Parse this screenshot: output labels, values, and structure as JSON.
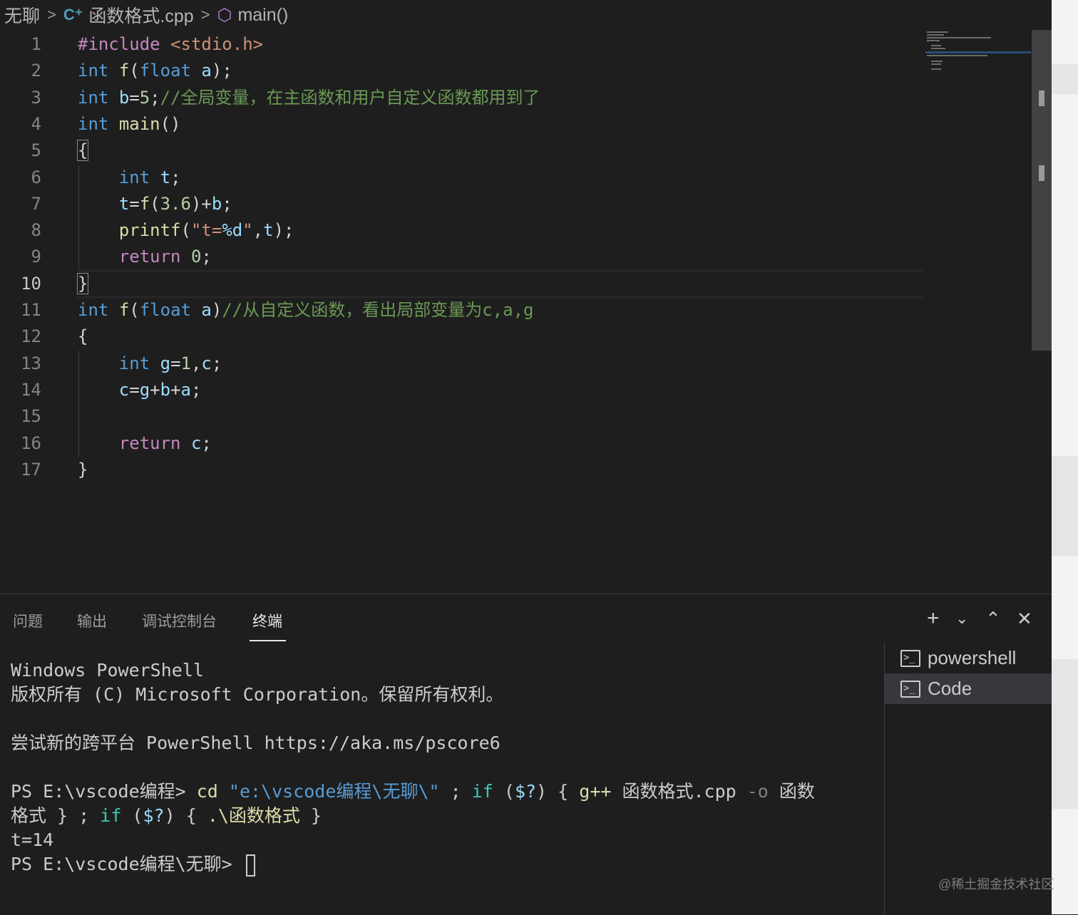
{
  "breadcrumb": {
    "folder": "无聊",
    "file_icon": "cpp-file-icon",
    "file": "函数格式.cpp",
    "symbol_icon": "method-cube-icon",
    "symbol": "main()"
  },
  "editor": {
    "language": "C",
    "active_line": 10,
    "line_numbers": [
      "1",
      "2",
      "3",
      "4",
      "5",
      "6",
      "7",
      "8",
      "9",
      "10",
      "11",
      "12",
      "13",
      "14",
      "15",
      "16",
      "17"
    ],
    "lines": [
      [
        {
          "t": "#include ",
          "c": "pp"
        },
        {
          "t": "<stdio.h>",
          "c": "str"
        }
      ],
      [
        {
          "t": "int",
          "c": "kw"
        },
        {
          "t": " "
        },
        {
          "t": "f",
          "c": "fn"
        },
        {
          "t": "("
        },
        {
          "t": "float",
          "c": "kw"
        },
        {
          "t": " "
        },
        {
          "t": "a",
          "c": "var"
        },
        {
          "t": ");"
        }
      ],
      [
        {
          "t": "int",
          "c": "kw"
        },
        {
          "t": " "
        },
        {
          "t": "b",
          "c": "var"
        },
        {
          "t": "="
        },
        {
          "t": "5",
          "c": "num"
        },
        {
          "t": ";"
        },
        {
          "t": "//全局变量，在主函数和用户自定义函数都用到了",
          "c": "cmt"
        }
      ],
      [
        {
          "t": "int",
          "c": "kw"
        },
        {
          "t": " "
        },
        {
          "t": "main",
          "c": "fn"
        },
        {
          "t": "()"
        }
      ],
      [
        {
          "t": "{",
          "c": "brkt"
        }
      ],
      [
        {
          "t": "    "
        },
        {
          "t": "int",
          "c": "kw"
        },
        {
          "t": " "
        },
        {
          "t": "t",
          "c": "var"
        },
        {
          "t": ";"
        }
      ],
      [
        {
          "t": "    "
        },
        {
          "t": "t",
          "c": "var"
        },
        {
          "t": "="
        },
        {
          "t": "f",
          "c": "fn"
        },
        {
          "t": "("
        },
        {
          "t": "3.6",
          "c": "num"
        },
        {
          "t": ")+"
        },
        {
          "t": "b",
          "c": "var"
        },
        {
          "t": ";"
        }
      ],
      [
        {
          "t": "    "
        },
        {
          "t": "printf",
          "c": "fn"
        },
        {
          "t": "("
        },
        {
          "t": "\"t=",
          "c": "str"
        },
        {
          "t": "%d",
          "c": "var"
        },
        {
          "t": "\"",
          "c": "str"
        },
        {
          "t": ","
        },
        {
          "t": "t",
          "c": "var"
        },
        {
          "t": ");"
        }
      ],
      [
        {
          "t": "    "
        },
        {
          "t": "return",
          "c": "ctl"
        },
        {
          "t": " "
        },
        {
          "t": "0",
          "c": "num"
        },
        {
          "t": ";"
        }
      ],
      [
        {
          "t": "}",
          "c": "brkt"
        }
      ],
      [
        {
          "t": "int",
          "c": "kw"
        },
        {
          "t": " "
        },
        {
          "t": "f",
          "c": "fn"
        },
        {
          "t": "("
        },
        {
          "t": "float",
          "c": "kw"
        },
        {
          "t": " "
        },
        {
          "t": "a",
          "c": "var"
        },
        {
          "t": ")"
        },
        {
          "t": "//从自定义函数，看出局部变量为c,a,g",
          "c": "cmt"
        }
      ],
      [
        {
          "t": "{"
        }
      ],
      [
        {
          "t": "    "
        },
        {
          "t": "int",
          "c": "kw"
        },
        {
          "t": " "
        },
        {
          "t": "g",
          "c": "var"
        },
        {
          "t": "="
        },
        {
          "t": "1",
          "c": "num"
        },
        {
          "t": ","
        },
        {
          "t": "c",
          "c": "var"
        },
        {
          "t": ";"
        }
      ],
      [
        {
          "t": "    "
        },
        {
          "t": "c",
          "c": "var"
        },
        {
          "t": "="
        },
        {
          "t": "g",
          "c": "var"
        },
        {
          "t": "+"
        },
        {
          "t": "b",
          "c": "var"
        },
        {
          "t": "+"
        },
        {
          "t": "a",
          "c": "var"
        },
        {
          "t": ";"
        }
      ],
      [],
      [
        {
          "t": "    "
        },
        {
          "t": "return",
          "c": "ctl"
        },
        {
          "t": " "
        },
        {
          "t": "c",
          "c": "var"
        },
        {
          "t": ";"
        }
      ],
      [
        {
          "t": "}"
        }
      ]
    ]
  },
  "panel": {
    "tabs": [
      "问题",
      "输出",
      "调试控制台",
      "终端"
    ],
    "active_tab": "终端",
    "actions": {
      "new_terminal": "+",
      "dropdown": "⌄",
      "maximize": "⌃",
      "close": "✕"
    },
    "terminal_lines": [
      [
        {
          "t": "Windows PowerShell"
        }
      ],
      [
        {
          "t": "版权所有 (C) Microsoft Corporation。保留所有权利。"
        }
      ],
      [],
      [
        {
          "t": "尝试新的跨平台 PowerShell https://aka.ms/pscore6"
        }
      ],
      [],
      [
        {
          "t": "PS E:\\vscode编程> "
        },
        {
          "t": "cd",
          "c": "t-cmd"
        },
        {
          "t": " "
        },
        {
          "t": "\"e:\\vscode编程\\无聊\\\"",
          "c": "t-str"
        },
        {
          "t": " ; "
        },
        {
          "t": "if",
          "c": "t-kw"
        },
        {
          "t": " ("
        },
        {
          "t": "$?",
          "c": "t-var"
        },
        {
          "t": ") { "
        },
        {
          "t": "g++",
          "c": "t-cmd"
        },
        {
          "t": " 函数格式.cpp "
        },
        {
          "t": "-o",
          "c": "t-arg"
        },
        {
          "t": " 函数"
        }
      ],
      [
        {
          "t": "格式 } ; "
        },
        {
          "t": "if",
          "c": "t-kw"
        },
        {
          "t": " ("
        },
        {
          "t": "$?",
          "c": "t-var"
        },
        {
          "t": ") { "
        },
        {
          "t": ".\\函数格式",
          "c": "t-cmd"
        },
        {
          "t": " }"
        }
      ],
      [
        {
          "t": "t=14"
        }
      ],
      [
        {
          "t": "PS E:\\vscode编程\\无聊> "
        }
      ]
    ],
    "terminals": [
      {
        "icon": "terminal-icon",
        "label": "powershell",
        "selected": false
      },
      {
        "icon": "terminal-icon",
        "label": "Code",
        "selected": true
      }
    ]
  },
  "watermark": "@稀土掘金技术社区"
}
